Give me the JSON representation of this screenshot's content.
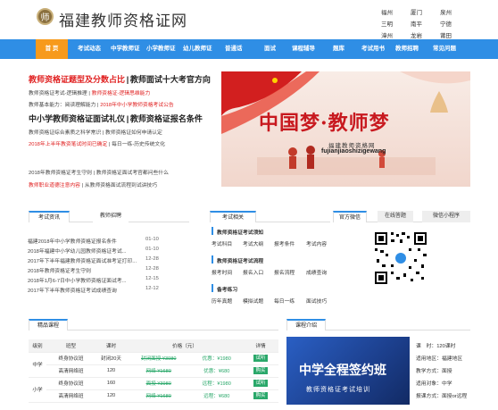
{
  "header": {
    "logo_char": "师",
    "site_name": "福建教师资格证网",
    "cities": [
      "福州",
      "厦门",
      "泉州",
      "三明",
      "南平",
      "宁德",
      "漳州",
      "龙岩",
      "莆田"
    ]
  },
  "nav": {
    "items": [
      "首 页",
      "考试动态",
      "中学教师证",
      "小学教师证",
      "幼儿教师证",
      "普通话",
      "面试",
      "课程辅导",
      "题库",
      "考试用书",
      "教师招聘",
      "常见问题"
    ]
  },
  "headlines": {
    "h1_red": "教师资格证题型及分数占比",
    "h1_sep": "|",
    "h1_blk": "教师面试十大考官方向",
    "row1_a": "教师资格证考试-逻辑推理",
    "row1_sep": "|",
    "row1_b": "教师资格证-逻辑思维能力",
    "row2_a": "教师基本能力：阅读理解能力",
    "row2_b": "2018年中小学教师资格考试公告",
    "h2_a": "中小学教师资格证面试礼仪",
    "h2_sep": "|",
    "h2_b": "教师资格证报名条件",
    "row3_a": "教师资格证综合素质之科学常识",
    "row3_b": "教师资格证如何申请认定",
    "row4_a": "2018年上半年教资笔试时间已确定",
    "row4_b": "每日一练-历史传统文化",
    "row5_a": "2018年教师资格证考生守则",
    "row5_b": "教师资格证面试考官都问些什么",
    "row6_a": "教师职业道德注意内容",
    "row6_b": "从教师资格面试流程到试讲技巧"
  },
  "banner": {
    "big_text": "中国梦·教师梦",
    "site": "福建教师资格网",
    "url": "fujianjiaoshizigewang"
  },
  "news_tabs": {
    "tabs": [
      "考试资讯",
      "教师招聘"
    ],
    "items": [
      {
        "title": "福建2018年中小学教师资格证报名条件",
        "date": "01-10"
      },
      {
        "title": "2018年福建中小学幼儿园教师资格证考试...",
        "date": "01-10"
      },
      {
        "title": "2017年下半年福建教师资格证面试准考证打印...",
        "date": "12-28"
      },
      {
        "title": "2018年教师资格证考生守则",
        "date": "12-28"
      },
      {
        "title": "2018年1月6-7日中小学教师资格证面试考...",
        "date": "12-15"
      },
      {
        "title": "2017年下半年教师资格证考试成绩查询",
        "date": "12-12"
      }
    ]
  },
  "exam_box": {
    "tab": "考试相关",
    "sec1_title": "教师资格证考试须知",
    "sec1_links": [
      "考试科目",
      "考试大纲",
      "报考条件",
      "考试内容"
    ],
    "sec2_title": "教师资格证考试流程",
    "sec2_links": [
      "报考时间",
      "报名入口",
      "报名流程",
      "成绩查询"
    ],
    "sec3_title": "备考练习",
    "sec3_links": [
      "历年真题",
      "模拟试题",
      "每日一练",
      "面试技巧"
    ]
  },
  "wechat_box": {
    "tabs": [
      "官方微信",
      "在线答题",
      "微信小程序"
    ]
  },
  "course_table": {
    "tab": "精品课程",
    "headers": [
      "级别",
      "班型",
      "课时",
      "价格（元）",
      "详情"
    ],
    "rows": [
      {
        "level": "中学",
        "type": "终身协议班",
        "hours": "封闭20天",
        "orig": "封闭面授 ¥3980",
        "sale": "优惠：¥1980",
        "btn": "试听"
      },
      {
        "level": "",
        "type": "高清网络班",
        "hours": "120",
        "orig": "网络 ¥1680",
        "sale": "优惠：¥680",
        "btn": "购买"
      },
      {
        "level": "小学",
        "type": "终身协议班",
        "hours": "160",
        "orig": "面授 ¥3980",
        "sale": "远程：¥1980",
        "btn": "试听"
      },
      {
        "level": "",
        "type": "高清网络班",
        "hours": "120",
        "orig": "网络 ¥1680",
        "sale": "远程：¥680",
        "btn": "购买"
      }
    ]
  },
  "course_recommend": {
    "tab": "课程介绍",
    "banner_text": "中学全程签约班",
    "banner_sub": "教师资格证考试培训",
    "details": [
      "课　时：120课时",
      "适用地区：福建地区",
      "教学方式：面授",
      "适用对象：中学",
      "报课方式：面授or远程"
    ]
  },
  "colors": {
    "nav_blue": "#2f8ee5",
    "nav_active": "#f79a1c",
    "red": "#e02020",
    "green": "#2aa86a"
  }
}
